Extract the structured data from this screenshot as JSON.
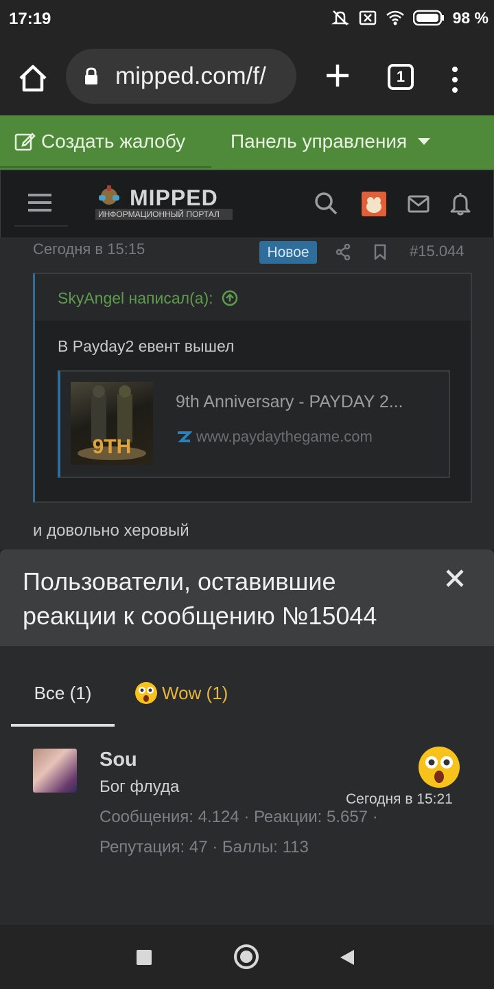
{
  "statusbar": {
    "time": "17:19",
    "battery": "98 %"
  },
  "browser": {
    "url": "mipped.com/f/",
    "tab_count": "1"
  },
  "greenbar": {
    "report_label": "Создать жалобу",
    "panel_label": "Панель управления"
  },
  "site": {
    "logo_title": "MIPPED",
    "logo_subtitle": "ИНФОРМАЦИОННЫЙ ПОРТАЛ"
  },
  "post": {
    "date": "Сегодня в 15:15",
    "badge": "Новое",
    "number": "#15.044",
    "quote_author": "SkyAngel написал(а):",
    "quote_text": "В Payday2 евент вышел",
    "embed_title": "9th Anniversary - PAYDAY 2...",
    "embed_url": "www.paydaythegame.com",
    "embed_image_label": "9TH",
    "body": "и довольно херовый"
  },
  "modal": {
    "title": "Пользователи, оставившие реакции к сообщению №15044",
    "tab_all": "Все (1)",
    "tab_wow": "Wow (1)",
    "user": {
      "name": "Sou",
      "title": "Бог флуда",
      "stats": "Сообщения: 4.124 · Реакции: 5.657 · Репутация: 47 · Баллы: 113",
      "time": "Сегодня в 15:21"
    }
  }
}
